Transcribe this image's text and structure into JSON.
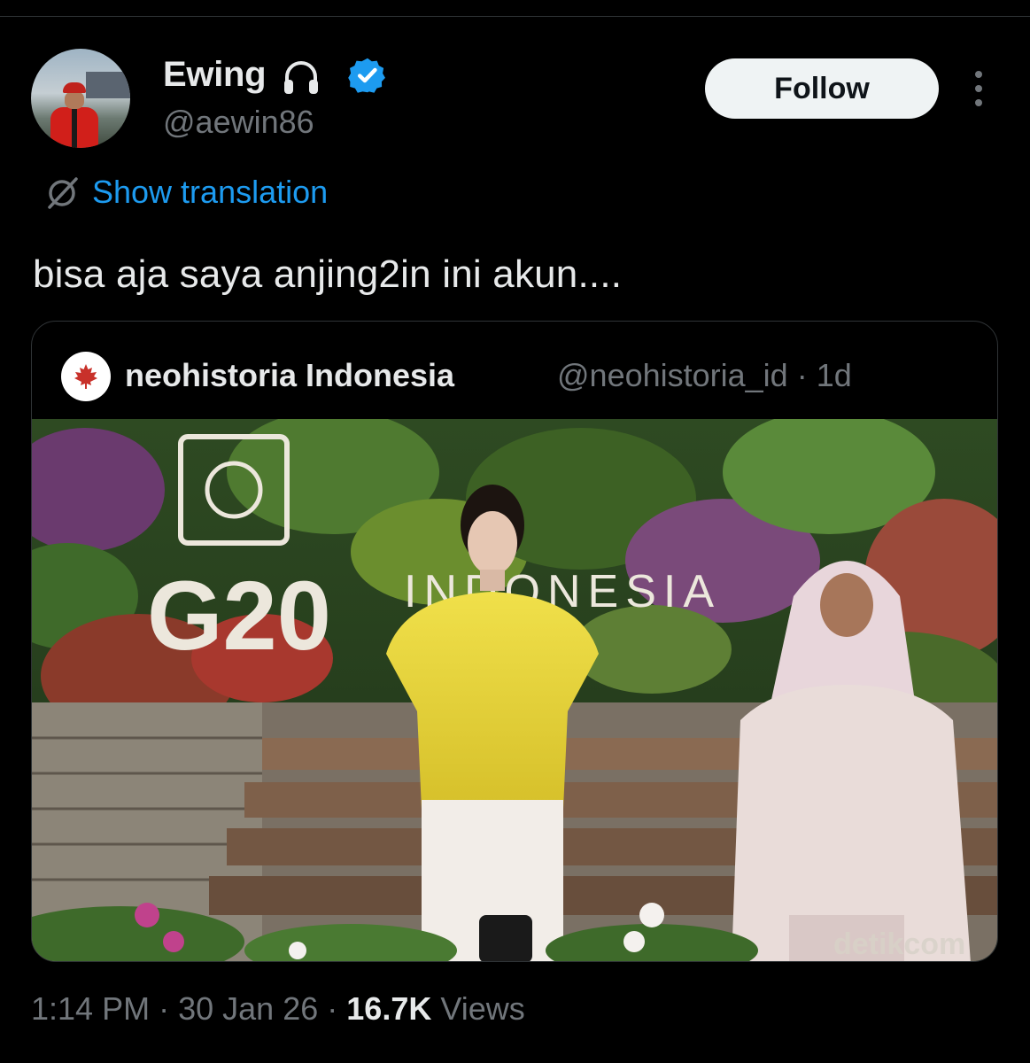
{
  "author": {
    "name": "Ewing",
    "handle": "@aewin86",
    "icons": [
      "headphones-icon",
      "verified-icon"
    ]
  },
  "follow_label": "Follow",
  "translation": {
    "label": "Show translation",
    "icon": "translate-icon"
  },
  "tweet_text": "bisa aja saya anjing2in ini akun....",
  "quoted": {
    "name": "neohistoria Indonesia",
    "handle": "@neohistoria_id",
    "separator": "·",
    "age": "1d",
    "image": {
      "sign_text": "G20",
      "sign_subtext": "INDONESIA",
      "watermark": "detikcom"
    }
  },
  "meta": {
    "time": "1:14 PM",
    "date": "30 Jan 26",
    "separator": "·",
    "views_count": "16.7K",
    "views_label": "Views"
  },
  "colors": {
    "background": "#000000",
    "link": "#1d9bf0",
    "secondary_text": "#71767b",
    "verified": "#1d9bf0",
    "follow_button_bg": "#eff3f4"
  }
}
